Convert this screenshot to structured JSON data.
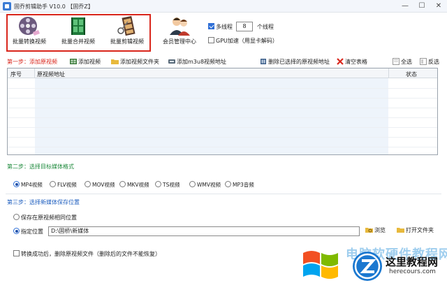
{
  "window": {
    "title": "固乔剪辑助手 V10.0 【固乔Z】",
    "minimize": "—",
    "maximize": "☐",
    "close": "✕"
  },
  "toolbar": {
    "tools": [
      {
        "label": "批量转换视频"
      },
      {
        "label": "批量合并视频"
      },
      {
        "label": "批量剪辑视频"
      },
      {
        "label": "会员管理中心"
      }
    ],
    "highlight_color": "#d9261c"
  },
  "options": {
    "multithread_label": "多线程",
    "thread_count": "8",
    "thread_unit": "个线程",
    "gpu_label": "GPU加速（用显卡解码）",
    "multithread_checked": true,
    "gpu_checked": false
  },
  "step1": {
    "title": "第一步：添加原视频",
    "actions": [
      {
        "label": "添加视频",
        "icon": "add-video-icon"
      },
      {
        "label": "添加视频文件夹",
        "icon": "folder-icon"
      },
      {
        "label": "添加m3u8视频地址",
        "icon": "link-icon"
      },
      {
        "label": "删除已选择的原视频地址",
        "icon": "delete-icon"
      },
      {
        "label": "清空表格",
        "icon": "clear-icon"
      },
      {
        "label": "全选",
        "icon": "select-all-icon"
      },
      {
        "label": "反选",
        "icon": "invert-select-icon"
      }
    ],
    "columns": [
      "序号",
      "原视频地址",
      "状态"
    ]
  },
  "step2": {
    "title": "第二步：选择目标媒体格式",
    "formats": [
      "MP4视频",
      "FLV视频",
      "MOV视频",
      "MKV视频",
      "TS视频",
      "WMV视频",
      "MP3音频"
    ],
    "selected": 0
  },
  "step3": {
    "title": "第三步：选择新媒体保存位置",
    "option_same": "保存在原视频相同位置",
    "option_custom": "指定位置",
    "path": "D:\\固桥\\新媒体",
    "browse": "浏览",
    "open_folder": "打开文件夹",
    "selected": "custom"
  },
  "footer": {
    "delete_after_label": "转换成功后，删除原视频文件（删除后的文件不能恢复）",
    "delete_after_checked": false
  },
  "watermark": {
    "text_faded": "电脑软硬件教程网",
    "logo_cn": "这里教程网",
    "logo_url": "herecours.com"
  }
}
